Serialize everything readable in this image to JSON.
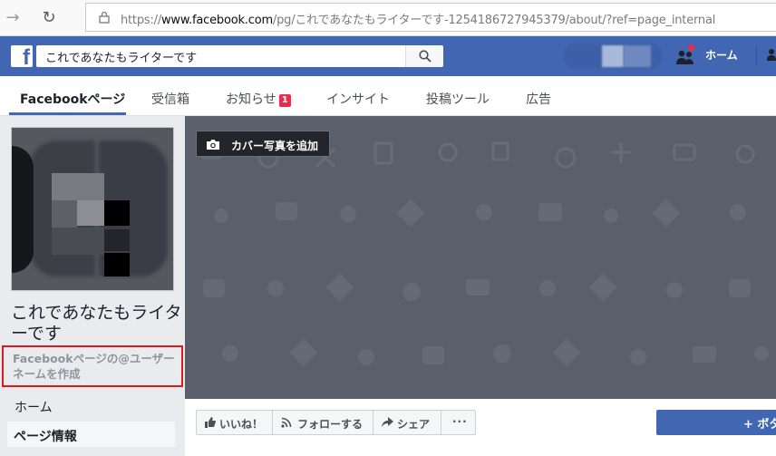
{
  "browser": {
    "url_prefix": "https://",
    "url_domain": "www.facebook.com",
    "url_path": "/pg/これであなたもライターです-1254186727945379/about/?ref=page_internal"
  },
  "header": {
    "search_value": "これであなたもライターです",
    "home_label": "ホーム"
  },
  "tabs": [
    {
      "label": "Facebookページ"
    },
    {
      "label": "受信箱"
    },
    {
      "label": "お知らせ",
      "badge": "1"
    },
    {
      "label": "インサイト"
    },
    {
      "label": "投稿ツール"
    },
    {
      "label": "広告"
    }
  ],
  "left": {
    "page_name": "これであなたもライターです",
    "username_link": "Facebookページの@ユーザーネームを作成",
    "nav_home": "ホーム",
    "nav_info": "ページ情報"
  },
  "cover": {
    "add_photo_label": "カバー写真を追加"
  },
  "actions": {
    "like": "いいね！",
    "follow": "フォローする",
    "share": "シェア",
    "more": "···",
    "primary": "+ ボタ"
  },
  "colors": {
    "brand": "#4267b2",
    "highlight_border": "#e0191a"
  }
}
